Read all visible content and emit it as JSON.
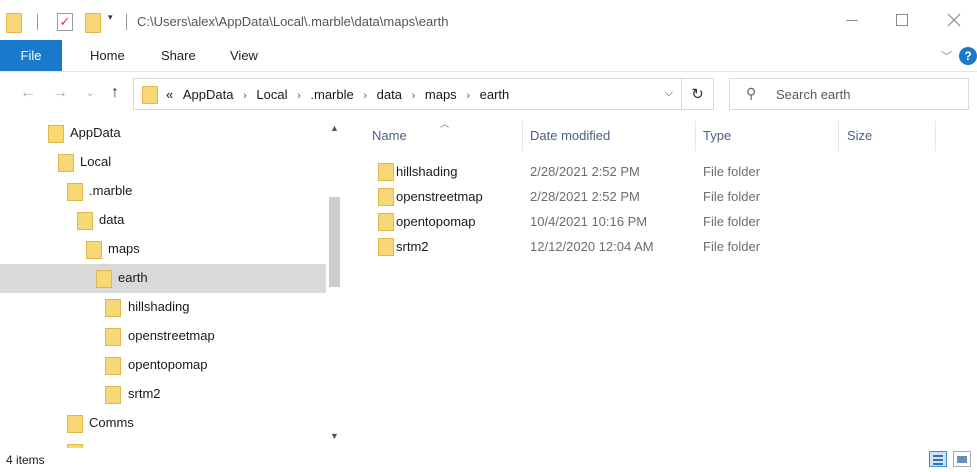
{
  "window": {
    "title_path": "C:\\Users\\alex\\AppData\\Local\\.marble\\data\\maps\\earth",
    "qat_check_glyph": "✓",
    "qat_dropdown_glyph": "▾"
  },
  "ribbon": {
    "tabs": [
      "File",
      "Home",
      "Share",
      "View"
    ],
    "help_glyph": "?",
    "expand_glyph": "﹀"
  },
  "address": {
    "overflow_glyph": "«",
    "crumbs": [
      "AppData",
      "Local",
      ".marble",
      "data",
      "maps",
      "earth"
    ],
    "separator": "›"
  },
  "search": {
    "placeholder": "Search earth"
  },
  "nav_tree": [
    {
      "label": "AppData",
      "level": 0,
      "selected": false
    },
    {
      "label": "Local",
      "level": 1,
      "selected": false
    },
    {
      "label": ".marble",
      "level": 2,
      "selected": false
    },
    {
      "label": "data",
      "level": 3,
      "selected": false
    },
    {
      "label": "maps",
      "level": 4,
      "selected": false
    },
    {
      "label": "earth",
      "level": 5,
      "selected": true
    },
    {
      "label": "hillshading",
      "level": 6,
      "selected": false
    },
    {
      "label": "openstreetmap",
      "level": 6,
      "selected": false
    },
    {
      "label": "opentopomap",
      "level": 6,
      "selected": false
    },
    {
      "label": "srtm2",
      "level": 6,
      "selected": false
    },
    {
      "label": "Comms",
      "level": 1,
      "selected": false
    }
  ],
  "file_list": {
    "columns": [
      "Name",
      "Date modified",
      "Type",
      "Size"
    ],
    "sorted_by": "Name",
    "rows": [
      {
        "name": "hillshading",
        "date": "2/28/2021 2:52 PM",
        "type": "File folder",
        "size": ""
      },
      {
        "name": "openstreetmap",
        "date": "2/28/2021 2:52 PM",
        "type": "File folder",
        "size": ""
      },
      {
        "name": "opentopomap",
        "date": "10/4/2021 10:16 PM",
        "type": "File folder",
        "size": ""
      },
      {
        "name": "srtm2",
        "date": "12/12/2020 12:04 AM",
        "type": "File folder",
        "size": ""
      }
    ]
  },
  "status": {
    "item_count": "4 items"
  },
  "colors": {
    "accent": "#1979ca",
    "folder": "#f8d775",
    "selection": "#d9d9d9",
    "header_text": "#4d6082"
  }
}
